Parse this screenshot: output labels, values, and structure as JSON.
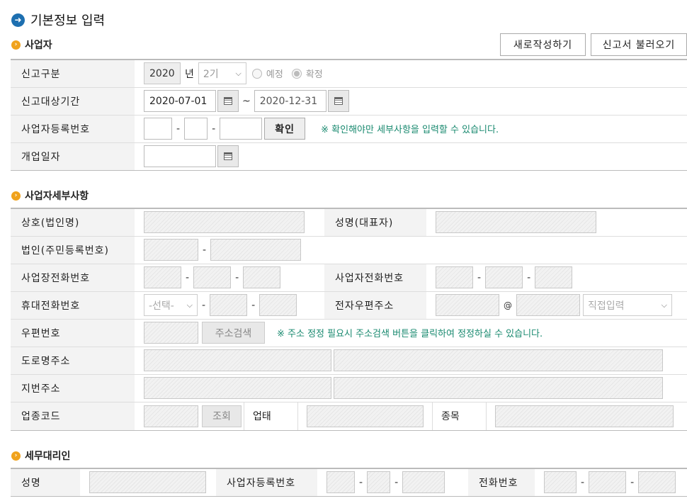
{
  "page_title": "기본정보 입력",
  "sections": {
    "business": "사업자",
    "details": "사업자세부사항",
    "agent": "세무대리인"
  },
  "buttons": {
    "new_write": "새로작성하기",
    "load_report": "신고서 불러오기",
    "confirm": "확인",
    "address_search": "주소검색",
    "lookup": "조회"
  },
  "business": {
    "report_type_label": "신고구분",
    "year": "2020",
    "year_unit": "년",
    "period": "2기",
    "radio_scheduled": "예정",
    "radio_final": "확정",
    "period_label": "신고대상기간",
    "start_date": "2020-07-01",
    "tilde": "~",
    "end_date": "2020-12-31",
    "regno_label": "사업자등록번호",
    "regno_note": "※ 확인해야만 세부사항을 입력할 수 있습니다.",
    "opendate_label": "개업일자"
  },
  "details": {
    "company_label": "상호(법인명)",
    "ceo_label": "성명(대표자)",
    "corp_id_label": "법인(주민등록번호)",
    "site_phone_label": "사업장전화번호",
    "biz_phone_label": "사업자전화번호",
    "mobile_label": "휴대전화번호",
    "mobile_select": "-선택-",
    "email_label": "전자우편주소",
    "at": "@",
    "email_domain": "직접입력",
    "zip_label": "우편번호",
    "zip_note": "※ 주소 정정 필요시 주소검색 버튼을 클릭하여 정정하실 수 있습니다.",
    "road_label": "도로명주소",
    "lot_label": "지번주소",
    "industry_label": "업종코드",
    "biztype_label": "업태",
    "item_label": "종목"
  },
  "agent": {
    "name_label": "성명",
    "regno_label": "사업자등록번호",
    "phone_label": "전화번호"
  },
  "dash": "-"
}
